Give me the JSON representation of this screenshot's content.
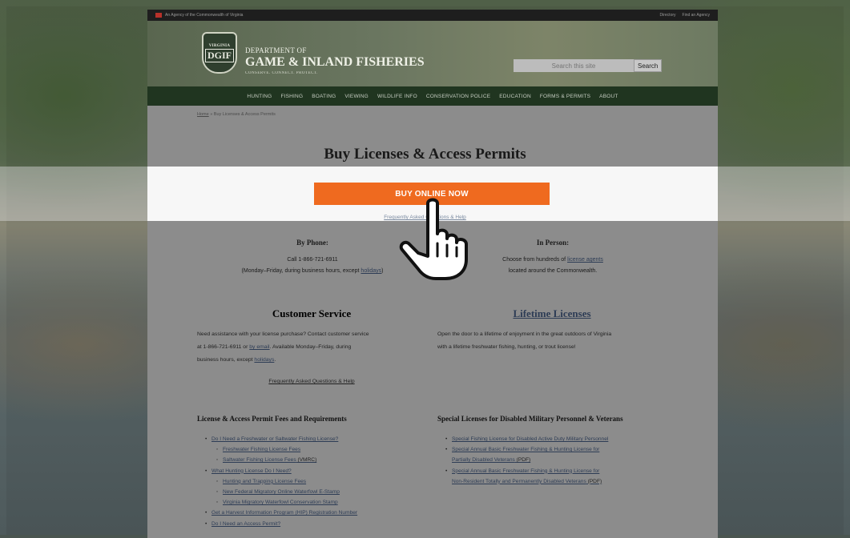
{
  "topbar": {
    "agency": "An Agency of the Commonwealth of Virginia",
    "links": [
      "Directory",
      "Find an Agency"
    ]
  },
  "header": {
    "logo_top": "VIRGINIA",
    "logo_main": "DGIF",
    "dept_line1": "DEPARTMENT OF",
    "dept_line2": "GAME & INLAND FISHERIES",
    "tagline": "CONSERVE. CONNECT. PROTECT.",
    "search_placeholder": "Search this site",
    "search_button": "Search"
  },
  "nav": [
    "HUNTING",
    "FISHING",
    "BOATING",
    "VIEWING",
    "WILDLIFE INFO",
    "CONSERVATION POLICE",
    "EDUCATION",
    "FORMS & PERMITS",
    "ABOUT"
  ],
  "breadcrumb": {
    "home": "Home",
    "separator": "»",
    "current": "Buy Licenses & Access Permits"
  },
  "page_title": "Buy Licenses & Access Permits",
  "buy_button": "BUY ONLINE NOW",
  "faq_top": "Frequently Asked Questions & Help",
  "by_phone": {
    "title": "By Phone:",
    "line1": "Call 1-866-721-6911",
    "line2_pre": "(Monday–Friday, during business hours, except ",
    "line2_link": "holidays",
    "line2_post": ")"
  },
  "in_person": {
    "title": "In Person:",
    "line1_pre": "Choose from hundreds of ",
    "line1_link": "license agents",
    "line2": "located around the Commonwealth."
  },
  "customer_service": {
    "title": "Customer Service",
    "text1": "Need assistance with your license purchase? Contact customer service",
    "text2_pre": "at 1-866-721-6911 or ",
    "text2_link": "by email",
    "text2_post": ". Available Monday–Friday, during",
    "text3_pre": "business hours, except ",
    "text3_link": "holidays",
    "text3_post": ".",
    "faq": "Frequently Asked Questions & Help"
  },
  "lifetime": {
    "title": "Lifetime Licenses",
    "text1": "Open the door to a lifetime of enjoyment in the great outdoors of Virginia",
    "text2": "with a lifetime freshwater fishing, hunting, or trout license!"
  },
  "fees": {
    "title": "License & Access Permit Fees and Requirements",
    "items": [
      {
        "text": "Do I Need a Freshwater or Saltwater Fishing License?",
        "level": 1
      },
      {
        "text": "Freshwater Fishing License Fees",
        "level": 2
      },
      {
        "text": "Saltwater Fishing License Fees",
        "suffix": " (VMRC)",
        "level": 2
      },
      {
        "text": "What Hunting License Do I Need?",
        "level": 1
      },
      {
        "text": "Hunting and Trapping License Fees",
        "level": 2
      },
      {
        "text": "New Federal Migratory Online Waterfowl E-Stamp",
        "level": 2
      },
      {
        "text": "Virginia Migratory Waterfowl Conservation Stamp",
        "level": 2
      },
      {
        "text": "Get a Harvest Information Program (HIP) Registration Number",
        "level": 1
      },
      {
        "text": "Do I Need an Access Permit?",
        "level": 1
      }
    ]
  },
  "special": {
    "title": "Special Licenses for Disabled Military Personnel & Veterans",
    "items": [
      {
        "lines": [
          "Special Fishing License for Disabled Active Duty Military Personnel"
        ]
      },
      {
        "lines": [
          "Special Annual Basic Freshwater Fishing & Hunting License for",
          "Partially Disabled Veterans"
        ],
        "suffix": " (PDF)"
      },
      {
        "lines": [
          "Special Annual Basic Freshwater Fishing & Hunting License for",
          "Non-Resident Totally and Permanently Disabled Veterans"
        ],
        "suffix": " (PDF)"
      }
    ]
  },
  "colors": {
    "nav_bg": "#203520",
    "buy_button": "#ef6a1f",
    "topbar": "#1e1e1e"
  }
}
